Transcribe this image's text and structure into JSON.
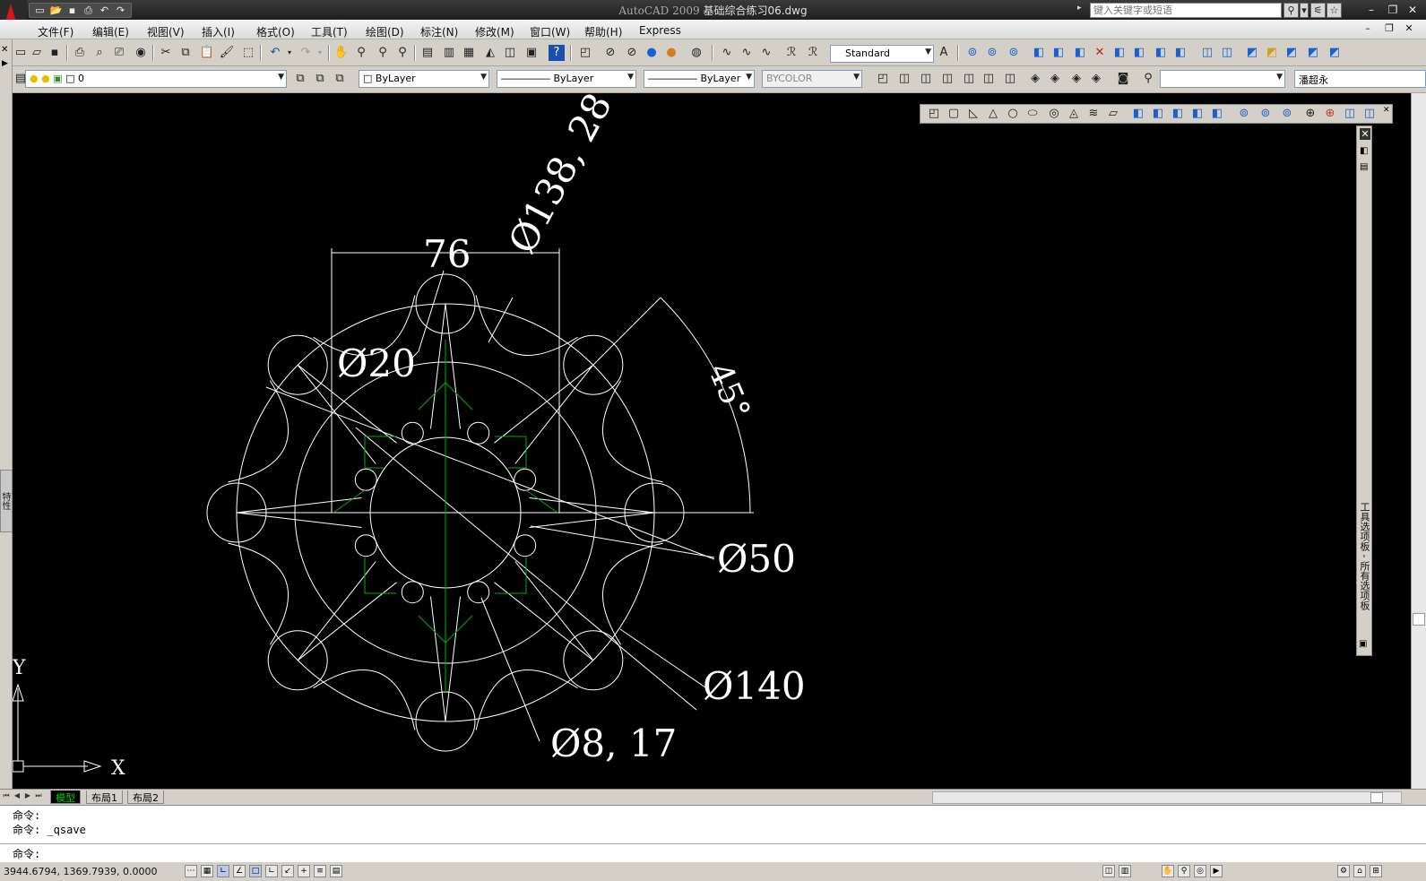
{
  "titlebar": {
    "version": "AutoCAD 2009",
    "filename": "基础综合练习06.dwg",
    "search_placeholder": "键入关键字或短语"
  },
  "menu": [
    "文件(F)",
    "编辑(E)",
    "视图(V)",
    "插入(I)",
    "格式(O)",
    "工具(T)",
    "绘图(D)",
    "标注(N)",
    "修改(M)",
    "窗口(W)",
    "帮助(H)",
    "Express"
  ],
  "layers": {
    "layer_name": "0",
    "color": "ByLayer",
    "linetype": "ByLayer",
    "lineweight": "ByLayer",
    "plotstyle": "BYCOLOR"
  },
  "styles": {
    "text_style": "Standard",
    "user": "潘超永"
  },
  "drawing": {
    "dims": {
      "width": "76",
      "outer_arc": "Ø138, 28",
      "angle": "45°",
      "small_circle": "Ø20",
      "center_circle": "Ø50",
      "bolt_circle": "Ø140",
      "notch": "Ø8, 17"
    },
    "ucs": {
      "x_label": "X",
      "y_label": "Y"
    },
    "colors": {
      "background": "#000000",
      "geometry": "#ffffff",
      "centerline": "#00b000"
    }
  },
  "palette": {
    "label": "工具选项板 - 所有选项板"
  },
  "properties_tab": "特性",
  "layout_tabs": [
    "模型",
    "布局1",
    "布局2"
  ],
  "command": {
    "line1": "命令:",
    "line2": "命令: _qsave",
    "prompt": "命令:"
  },
  "status": {
    "coords": "3944.6794, 1369.7939, 0.0000"
  }
}
